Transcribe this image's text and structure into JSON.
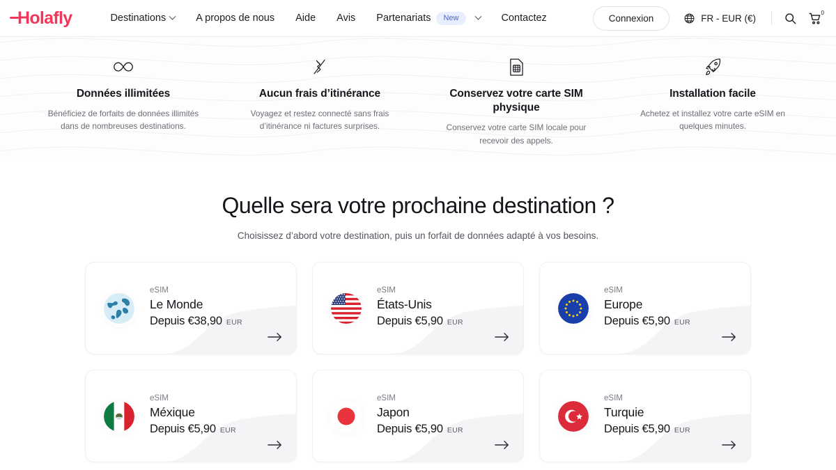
{
  "header": {
    "logo": "Holafly",
    "nav": [
      {
        "label": "Destinations",
        "icon": "chevron-down-icon",
        "has_chevron": true,
        "badge": ""
      },
      {
        "label": "A propos de nous",
        "has_chevron": false,
        "badge": ""
      },
      {
        "label": "Aide",
        "has_chevron": false,
        "badge": ""
      },
      {
        "label": "Avis",
        "has_chevron": false,
        "badge": ""
      },
      {
        "label": "Partenariats",
        "has_chevron": true,
        "badge": "New"
      },
      {
        "label": "Contactez",
        "has_chevron": false,
        "badge": ""
      }
    ],
    "login_label": "Connexion",
    "locale_label": "FR - EUR (€)",
    "globe_icon": "globe-icon",
    "search_icon": "search-icon",
    "cart_icon": "cart-icon",
    "cart_count": "0",
    "accent_color": "#f2385a",
    "badge_bg": "#e8eeff",
    "badge_color": "#4666d6"
  },
  "features": [
    {
      "icon": "infinity-icon",
      "title": "Données illimitées",
      "desc": "Bénéficiez de forfaits de données illimités dans de nombreuses destinations."
    },
    {
      "icon": "no-roaming-fees-icon",
      "title": "Aucun frais d’itinérance",
      "desc": "Voyagez et restez connecté sans frais d’itinérance ni factures surprises."
    },
    {
      "icon": "sim-card-icon",
      "title": "Conservez votre carte SIM physique",
      "desc": "Conservez votre carte SIM locale pour recevoir des appels."
    },
    {
      "icon": "rocket-icon",
      "title": "Installation facile",
      "desc": "Achetez et installez votre carte eSIM en quelques minutes."
    }
  ],
  "main": {
    "title": "Quelle sera votre prochaine destination ?",
    "subtitle": "Choisissez d’abord votre destination, puis un forfait de données adapté à vos besoins.",
    "cards": [
      {
        "flag": "world-globe-flag",
        "esim": "eSIM",
        "name": "Le Monde",
        "price": "Depuis €38,90",
        "currency": "EUR",
        "arrow": "arrow-right-icon"
      },
      {
        "flag": "united-states-flag",
        "esim": "eSIM",
        "name": "États-Unis",
        "price": "Depuis €5,90",
        "currency": "EUR",
        "arrow": "arrow-right-icon"
      },
      {
        "flag": "europe-flag",
        "esim": "eSIM",
        "name": "Europe",
        "price": "Depuis €5,90",
        "currency": "EUR",
        "arrow": "arrow-right-icon"
      },
      {
        "flag": "mexico-flag",
        "esim": "eSIM",
        "name": "Méxique",
        "price": "Depuis €5,90",
        "currency": "EUR",
        "arrow": "arrow-right-icon"
      },
      {
        "flag": "japan-flag",
        "esim": "eSIM",
        "name": "Japon",
        "price": "Depuis €5,90",
        "currency": "EUR",
        "arrow": "arrow-right-icon"
      },
      {
        "flag": "turkey-flag",
        "esim": "eSIM",
        "name": "Turquie",
        "price": "Depuis €5,90",
        "currency": "EUR",
        "arrow": "arrow-right-icon"
      }
    ]
  }
}
